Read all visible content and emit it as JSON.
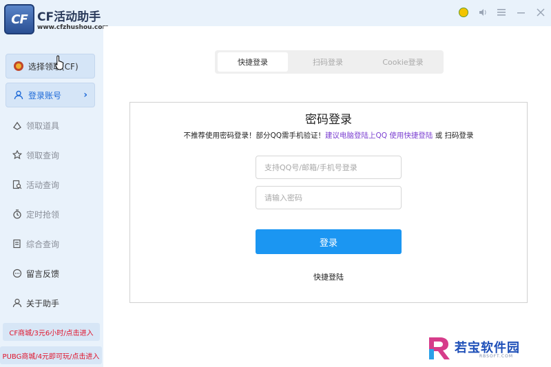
{
  "app": {
    "logo_text": "CF",
    "title": "CF活动助手",
    "url": "www.cfzhushou.com"
  },
  "window_controls": {
    "qq_icon": "qq-penguin-icon",
    "speaker_icon": "speaker-icon",
    "menu_icon": "menu-icon",
    "minimize_icon": "minimize-icon",
    "close_icon": "close-icon"
  },
  "sidebar": {
    "select_label": "选择领取(CF)",
    "login_label": "登录账号",
    "items": [
      {
        "label": "领取道具",
        "icon": "gift-icon"
      },
      {
        "label": "领取查询",
        "icon": "star-search-icon"
      },
      {
        "label": "活动查询",
        "icon": "document-search-icon"
      },
      {
        "label": "定时抢领",
        "icon": "timer-icon"
      },
      {
        "label": "综合查询",
        "icon": "list-icon"
      },
      {
        "label": "留言反馈",
        "icon": "chat-icon"
      },
      {
        "label": "关于助手",
        "icon": "user-icon"
      }
    ],
    "promos": [
      "CF商城/3元6小时/点击进入",
      "PUBG商城/4元即可玩/点击进入"
    ]
  },
  "tabs": [
    "快捷登录",
    "扫码登录",
    "Cookie登录"
  ],
  "login": {
    "title": "密码登录",
    "hint_prefix": "不推荐使用密码登录！部分QQ需手机验证！",
    "hint_link": "建议电脑登陆上QQ 使用快捷登陆",
    "hint_suffix": " 或 扫码登录",
    "username_placeholder": "支持QQ号/邮箱/手机号登录",
    "password_placeholder": "请输入密码",
    "submit_label": "登录",
    "quick_label": "快捷登陆"
  },
  "watermark": {
    "text": "若宝软件园",
    "sub": "RBSOFT.COM"
  },
  "colors": {
    "accent": "#1b96f2",
    "link": "#7b3fd1",
    "promo": "#e0122a",
    "sidebar_bg": "#e9f2fb"
  }
}
